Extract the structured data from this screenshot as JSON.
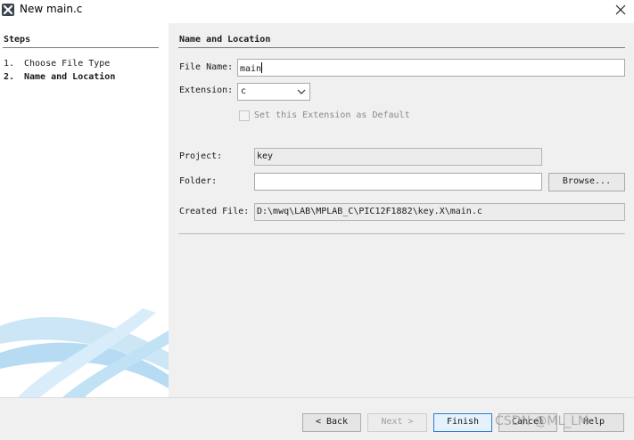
{
  "window": {
    "title": "New main.c",
    "icon": "netbeans-logo-icon",
    "close_icon": "close-icon"
  },
  "steps": {
    "title": "Steps",
    "items": [
      {
        "num": "1.",
        "label": "Choose File Type",
        "current": false
      },
      {
        "num": "2.",
        "label": "Name and Location",
        "current": true
      }
    ]
  },
  "content": {
    "title": "Name and Location",
    "file_name": {
      "label": "File Name:",
      "value": "main"
    },
    "extension": {
      "label": "Extension:",
      "value": "c"
    },
    "set_default": {
      "label": "Set this Extension as Default",
      "checked": false,
      "enabled": false
    },
    "project": {
      "label": "Project:",
      "value": "key"
    },
    "folder": {
      "label": "Folder:",
      "value": ""
    },
    "browse_label": "Browse...",
    "created_file": {
      "label": "Created File:",
      "value": "D:\\mwq\\LAB\\MPLAB_C\\PIC12F1882\\key.X\\main.c"
    }
  },
  "footer": {
    "back_label": "< Back",
    "next_label": "Next >",
    "finish_label": "Finish",
    "cancel_label": "Cancel",
    "help_label": "Help",
    "watermark": "CSDN @ML_LM"
  },
  "colors": {
    "accent": "#2a7ad6",
    "panel": "#f0f0f0",
    "swoosh": "#a9d4f0"
  }
}
